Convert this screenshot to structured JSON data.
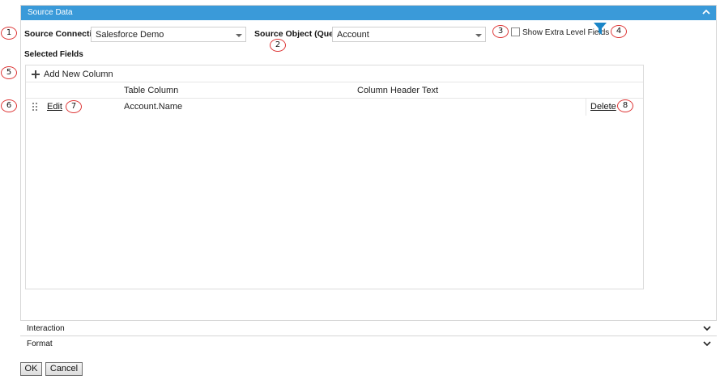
{
  "panel": {
    "title": "Source Data"
  },
  "source_connection": {
    "label": "Source Connection",
    "value": "Salesforce Demo"
  },
  "source_object": {
    "label": "Source Object (Query)",
    "value": "Account"
  },
  "extra_fields": {
    "label": "Show Extra Level Fields",
    "checked": false
  },
  "selected_fields": {
    "label": "Selected Fields",
    "add_label": "Add New Column",
    "headers": [
      "Table Column",
      "Column Header Text"
    ],
    "rows": [
      {
        "edit": "Edit",
        "table_column": "Account.Name",
        "header_text": "",
        "delete": "Delete"
      }
    ]
  },
  "callouts": [
    "1",
    "2",
    "3",
    "4",
    "5",
    "6",
    "7",
    "8"
  ],
  "accordions": {
    "interaction": "Interaction",
    "format": "Format"
  },
  "buttons": {
    "ok": "OK",
    "cancel": "Cancel"
  },
  "icons": {
    "filter": "filter-icon",
    "collapse": "chevron-up-icon",
    "expand": "chevron-down-icon",
    "add": "plus-icon",
    "drag": "drag-handle-icon"
  },
  "colors": {
    "header_blue": "#3a9ad9",
    "filter_blue": "#1a86c8",
    "callout_red": "#dd3333"
  }
}
